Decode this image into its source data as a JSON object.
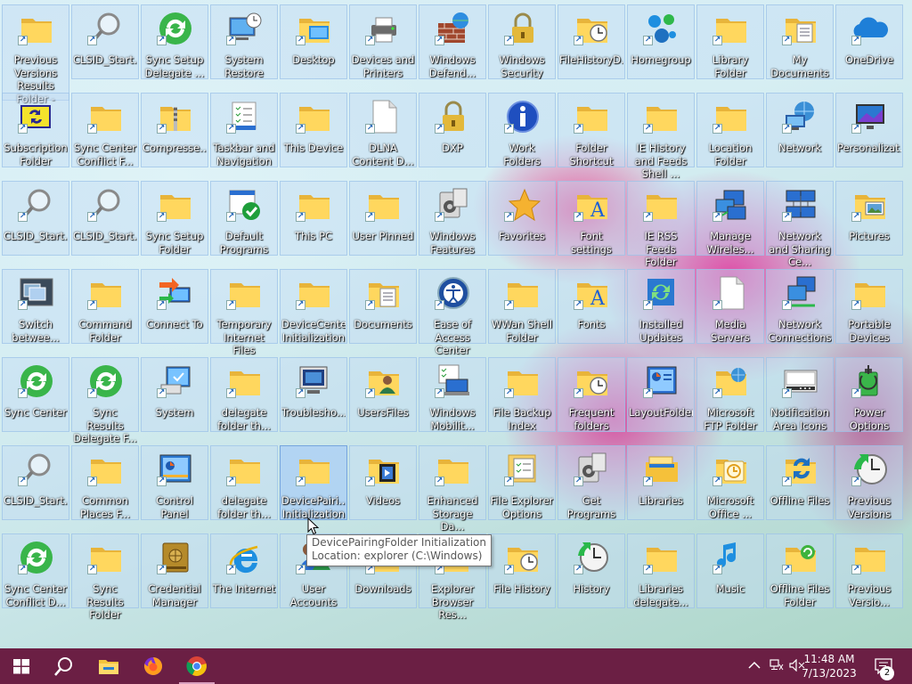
{
  "desktop": {
    "rows": [
      [
        {
          "label": "Previous Versions Results Folder - Copy",
          "icon": "folder-icon"
        },
        {
          "label": "CLSID_Start...",
          "icon": "magnifier-icon"
        },
        {
          "label": "Sync Setup Delegate ...",
          "icon": "sync-green-icon"
        },
        {
          "label": "System Restore",
          "icon": "system-restore-icon"
        },
        {
          "label": "Desktop",
          "icon": "desktop-folder-icon"
        },
        {
          "label": "Devices and Printers",
          "icon": "printer-icon"
        },
        {
          "label": "Windows Defend...",
          "icon": "firewall-icon"
        },
        {
          "label": "Windows Security",
          "icon": "lock-icon"
        },
        {
          "label": "FileHistoryD...",
          "icon": "folder-clock-icon"
        },
        {
          "label": "Homegroup",
          "icon": "homegroup-icon"
        },
        {
          "label": "Library Folder",
          "icon": "folder-icon"
        },
        {
          "label": "My Documents",
          "icon": "documents-folder-icon"
        },
        {
          "label": "OneDrive",
          "icon": "cloud-icon"
        }
      ],
      [
        {
          "label": "Subscription Folder",
          "icon": "subscription-icon"
        },
        {
          "label": "Sync Center Conflict F...",
          "icon": "folder-icon"
        },
        {
          "label": "Compresse...",
          "icon": "zip-folder-icon"
        },
        {
          "label": "Taskbar and Navigation",
          "icon": "taskbar-settings-icon"
        },
        {
          "label": "This Device",
          "icon": "folder-icon"
        },
        {
          "label": "DLNA Content D...",
          "icon": "blank-page-icon"
        },
        {
          "label": "DXP",
          "icon": "lock-icon"
        },
        {
          "label": "Work Folders",
          "icon": "info-icon"
        },
        {
          "label": "Folder Shortcut",
          "icon": "folder-icon"
        },
        {
          "label": "IE History and Feeds Shell ...",
          "icon": "folder-icon"
        },
        {
          "label": "Location Folder",
          "icon": "folder-icon"
        },
        {
          "label": "Network",
          "icon": "network-icon"
        },
        {
          "label": "Personalizat...",
          "icon": "personalization-icon"
        }
      ],
      [
        {
          "label": "CLSID_Start...",
          "icon": "magnifier-icon"
        },
        {
          "label": "CLSID_Start...",
          "icon": "magnifier-icon"
        },
        {
          "label": "Sync Setup Folder",
          "icon": "folder-icon"
        },
        {
          "label": "Default Programs",
          "icon": "default-programs-icon"
        },
        {
          "label": "This PC",
          "icon": "folder-icon"
        },
        {
          "label": "User Pinned",
          "icon": "folder-icon"
        },
        {
          "label": "Windows Features",
          "icon": "features-icon"
        },
        {
          "label": "Favorites",
          "icon": "star-icon"
        },
        {
          "label": "Font settings",
          "icon": "font-folder-icon"
        },
        {
          "label": "IE RSS Feeds Folder",
          "icon": "folder-icon"
        },
        {
          "label": "Manage Wireles...",
          "icon": "wireless-icon"
        },
        {
          "label": "Network and Sharing Ce...",
          "icon": "network-sharing-icon"
        },
        {
          "label": "Pictures",
          "icon": "pictures-folder-icon"
        }
      ],
      [
        {
          "label": "Switch betwee...",
          "icon": "switch-windows-icon"
        },
        {
          "label": "Command Folder",
          "icon": "folder-icon"
        },
        {
          "label": "Connect To",
          "icon": "connect-to-icon"
        },
        {
          "label": "Temporary Internet Files",
          "icon": "folder-icon"
        },
        {
          "label": "DeviceCenter Initialization",
          "icon": "folder-icon"
        },
        {
          "label": "Documents",
          "icon": "documents-folder-icon"
        },
        {
          "label": "Ease of Access Center",
          "icon": "ease-of-access-icon"
        },
        {
          "label": "WWan Shell Folder",
          "icon": "folder-icon"
        },
        {
          "label": "Fonts",
          "icon": "font-folder-icon"
        },
        {
          "label": "Installed Updates",
          "icon": "updates-icon"
        },
        {
          "label": "Media Servers",
          "icon": "blank-page-icon"
        },
        {
          "label": "Network Connections",
          "icon": "network-connections-icon"
        },
        {
          "label": "Portable Devices",
          "icon": "folder-icon"
        }
      ],
      [
        {
          "label": "Sync Center",
          "icon": "sync-green-icon"
        },
        {
          "label": "Sync Results Delegate F...",
          "icon": "sync-green-icon"
        },
        {
          "label": "System",
          "icon": "system-icon"
        },
        {
          "label": "delegate folder th...",
          "icon": "folder-icon"
        },
        {
          "label": "Troublesho...",
          "icon": "troubleshoot-icon"
        },
        {
          "label": "UsersFiles",
          "icon": "user-folder-icon"
        },
        {
          "label": "Windows Mobilit...",
          "icon": "mobility-icon"
        },
        {
          "label": "File Backup Index",
          "icon": "folder-icon"
        },
        {
          "label": "Frequent folders",
          "icon": "folder-clock-icon"
        },
        {
          "label": "LayoutFolder",
          "icon": "layout-icon"
        },
        {
          "label": "Microsoft FTP Folder",
          "icon": "ftp-folder-icon"
        },
        {
          "label": "Notification Area Icons",
          "icon": "notification-area-icon"
        },
        {
          "label": "Power Options",
          "icon": "power-options-icon"
        }
      ],
      [
        {
          "label": "CLSID_Start...",
          "icon": "magnifier-icon"
        },
        {
          "label": "Common Places F...",
          "icon": "folder-icon"
        },
        {
          "label": "Control Panel",
          "icon": "control-panel-icon"
        },
        {
          "label": "delegate folder th...",
          "icon": "folder-icon"
        },
        {
          "label": "DevicePairi... Initialization",
          "icon": "folder-icon"
        },
        {
          "label": "Videos",
          "icon": "videos-folder-icon"
        },
        {
          "label": "Enhanced Storage Da...",
          "icon": "folder-icon"
        },
        {
          "label": "File Explorer Options",
          "icon": "explorer-options-icon"
        },
        {
          "label": "Get Programs",
          "icon": "features-icon"
        },
        {
          "label": "Libraries",
          "icon": "libraries-icon"
        },
        {
          "label": "Microsoft Office ...",
          "icon": "office-folder-icon"
        },
        {
          "label": "Offline Files",
          "icon": "offline-files-icon"
        },
        {
          "label": "Previous Versions",
          "icon": "previous-versions-icon"
        }
      ],
      [
        {
          "label": "Sync Center Conflict D...",
          "icon": "sync-green-icon"
        },
        {
          "label": "Sync Results Folder",
          "icon": "folder-icon"
        },
        {
          "label": "Credential Manager",
          "icon": "credential-vault-icon"
        },
        {
          "label": "The Internet",
          "icon": "internet-explorer-icon"
        },
        {
          "label": "User Accounts",
          "icon": "user-accounts-icon"
        },
        {
          "label": "Downloads",
          "icon": "downloads-folder-icon"
        },
        {
          "label": "Explorer Browser Res...",
          "icon": "folder-icon"
        },
        {
          "label": "File History",
          "icon": "folder-clock-icon"
        },
        {
          "label": "History",
          "icon": "history-icon"
        },
        {
          "label": "Libraries delegate...",
          "icon": "folder-icon"
        },
        {
          "label": "Music",
          "icon": "music-folder-icon"
        },
        {
          "label": "Offline Files Folder",
          "icon": "offline-folder-icon"
        },
        {
          "label": "Previous Versio...",
          "icon": "folder-icon"
        }
      ]
    ]
  },
  "tooltip": {
    "line1": "DevicePairingFolder Initialization",
    "line2": "Location: explorer (C:\\Windows)"
  },
  "taskbar": {
    "start_icon": "windows-logo-icon",
    "search_icon": "search-icon",
    "pinned": [
      "file-explorer-icon",
      "firefox-icon",
      "chrome-icon"
    ],
    "clock_time": "11:48 AM",
    "clock_date": "7/13/2023",
    "notification_count": "2",
    "color": "#6b1f44"
  }
}
